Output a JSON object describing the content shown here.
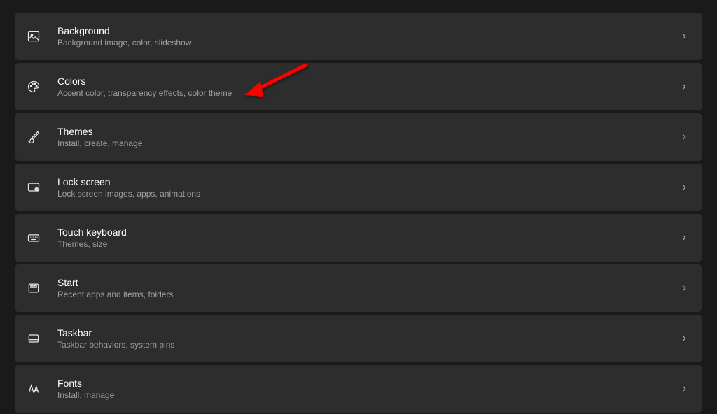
{
  "colors": {
    "background": "#1a1a1a",
    "card": "#2d2d2d",
    "title": "#ffffff",
    "description": "#a0a0a0",
    "chevron": "#b0b0b0",
    "arrow": "#ff0000"
  },
  "items": [
    {
      "icon": "picture-icon",
      "title": "Background",
      "desc": "Background image, color, slideshow"
    },
    {
      "icon": "palette-icon",
      "title": "Colors",
      "desc": "Accent color, transparency effects, color theme"
    },
    {
      "icon": "brush-icon",
      "title": "Themes",
      "desc": "Install, create, manage"
    },
    {
      "icon": "lock-screen-icon",
      "title": "Lock screen",
      "desc": "Lock screen images, apps, animations"
    },
    {
      "icon": "keyboard-icon",
      "title": "Touch keyboard",
      "desc": "Themes, size"
    },
    {
      "icon": "start-icon",
      "title": "Start",
      "desc": "Recent apps and items, folders"
    },
    {
      "icon": "taskbar-icon",
      "title": "Taskbar",
      "desc": "Taskbar behaviors, system pins"
    },
    {
      "icon": "fonts-icon",
      "title": "Fonts",
      "desc": "Install, manage"
    }
  ],
  "annotation": {
    "type": "arrow",
    "target": "Colors"
  }
}
